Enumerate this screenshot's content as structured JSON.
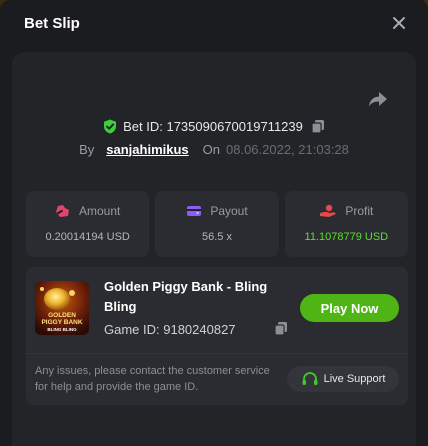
{
  "header": {
    "title": "Bet Slip"
  },
  "bet": {
    "id_label": "Bet ID: 1735090670019711239",
    "by_label": "By",
    "username": "sanjahimikus",
    "on_label": "On",
    "date": "08.06.2022, 21:03:28"
  },
  "stats": [
    {
      "label": "Amount",
      "value": "0.20014194 USD",
      "icon": "money-bag-icon"
    },
    {
      "label": "Payout",
      "value": "56.5 x",
      "icon": "wallet-icon"
    },
    {
      "label": "Profit",
      "value": "11.1078779 USD",
      "icon": "hand-money-icon"
    }
  ],
  "game": {
    "title": "Golden Piggy Bank - Bling Bling",
    "id_label": "Game ID: 9180240827",
    "thumb_text_1": "GOLDEN",
    "thumb_text_2": "PIGGY BANK",
    "thumb_text_3": "BLING BLING",
    "play_label": "Play Now"
  },
  "support": {
    "notice": "Any issues, please contact the customer service for help and provide the game ID.",
    "button_label": "Live Support"
  },
  "colors": {
    "accent_green": "#4fb514",
    "profit_green": "#5fdd2f",
    "shield_green": "#3ad13a",
    "icon_pink": "#e0456e",
    "icon_purple": "#8b5cf6",
    "icon_red": "#e8484a"
  }
}
